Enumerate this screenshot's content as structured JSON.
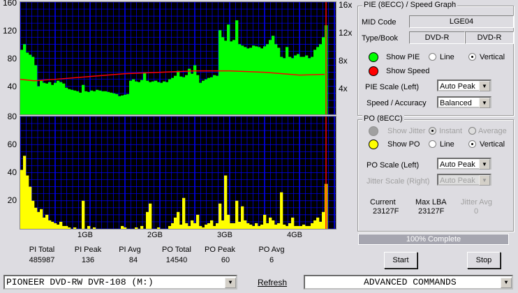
{
  "chart_data": [
    {
      "type": "bar",
      "title": "PI (8ECC)",
      "ylabel": "PIE",
      "ylim": [
        0,
        160
      ],
      "yticks": [
        40,
        80,
        120,
        160
      ],
      "xlim_gb": [
        0,
        4.5
      ],
      "x_step_gb": 0.04,
      "xticks": [
        "1GB",
        "2GB",
        "3GB",
        "4GB"
      ],
      "values": [
        92,
        100,
        88,
        85,
        82,
        70,
        40,
        48,
        45,
        44,
        46,
        42,
        45,
        48,
        46,
        44,
        38,
        36,
        35,
        34,
        33,
        31,
        42,
        33,
        32,
        34,
        33,
        35,
        34,
        33,
        33,
        32,
        31,
        30,
        29,
        26,
        27,
        28,
        29,
        48,
        50,
        47,
        46,
        49,
        60,
        48,
        46,
        47,
        48,
        46,
        45,
        47,
        46,
        50,
        52,
        55,
        62,
        54,
        53,
        56,
        65,
        58,
        70,
        56,
        45,
        48,
        50,
        52,
        53,
        56,
        55,
        120,
        110,
        105,
        128,
        104,
        106,
        134,
        100,
        98,
        96,
        94,
        95,
        98,
        97,
        96,
        94,
        97,
        100,
        106,
        112,
        100,
        95,
        82,
        80,
        96,
        82,
        80,
        84,
        86,
        82,
        82,
        84,
        80,
        82,
        92,
        96,
        100,
        110,
        127
      ],
      "speed": {
        "name": "Speed",
        "y2ticks": [
          "4x",
          "8x",
          "12x",
          "16x"
        ],
        "y2lim": [
          0,
          16
        ],
        "x": [
          0,
          0.2,
          0.5,
          1.0,
          1.5,
          2.0,
          2.5,
          3.0,
          3.5,
          4.0,
          4.36
        ],
        "y": [
          5,
          4.8,
          5,
          5.4,
          5.8,
          6.0,
          6.2,
          6.2,
          6.0,
          5.6,
          5.7
        ]
      },
      "end_gb": 4.38
    },
    {
      "type": "bar",
      "title": "PO (8ECC)",
      "ylim": [
        0,
        80
      ],
      "yticks": [
        20,
        40,
        60,
        80
      ],
      "x_step_gb": 0.04,
      "values": [
        42,
        52,
        38,
        30,
        20,
        15,
        12,
        14,
        8,
        10,
        6,
        5,
        4,
        3,
        5,
        2,
        2,
        1,
        0,
        1,
        0,
        0,
        20,
        0,
        2,
        0,
        1,
        0,
        0,
        0,
        0,
        0,
        0,
        0,
        0,
        0,
        2,
        1,
        0,
        0,
        0,
        1,
        0,
        2,
        0,
        12,
        18,
        0,
        0,
        1,
        0,
        0,
        0,
        2,
        4,
        8,
        12,
        3,
        22,
        4,
        2,
        6,
        4,
        10,
        2,
        1,
        3,
        4,
        6,
        2,
        4,
        18,
        6,
        38,
        10,
        4,
        4,
        20,
        5,
        16,
        6,
        4,
        3,
        2,
        4,
        2,
        3,
        10,
        4,
        8,
        6,
        3,
        4,
        26,
        3,
        2,
        4,
        8,
        2,
        2,
        2,
        3,
        2,
        2,
        4,
        6,
        8,
        5,
        12,
        32
      ]
    }
  ],
  "colors": {
    "pi": "#00ff00",
    "po": "#ffff00",
    "speed": "#ff0000",
    "grid": "#0000ff"
  },
  "stats": [
    {
      "label": "PI Total",
      "value": "485987"
    },
    {
      "label": "PI Peak",
      "value": "136"
    },
    {
      "label": "PI Avg",
      "value": "84"
    },
    {
      "label": "PO Total",
      "value": "14540"
    },
    {
      "label": "PO Peak",
      "value": "60"
    },
    {
      "label": "PO Avg",
      "value": "6"
    }
  ],
  "pie": {
    "title": "PIE (8ECC) / Speed Graph",
    "mid_label": "MID Code",
    "mid": "LGE04",
    "type_label": "Type/Book",
    "type": "DVD-R",
    "book": "DVD-R",
    "show_pie": "Show PIE",
    "line": "Line",
    "vertical": "Vertical",
    "show_speed": "Show Speed",
    "scale_label": "PIE Scale (Left)",
    "scale": "Auto Peak",
    "speed_label": "Speed / Accuracy",
    "speed": "Balanced"
  },
  "po": {
    "title": "PO (8ECC)",
    "show_jitter": "Show Jitter",
    "instant": "Instant",
    "average": "Average",
    "show_po": "Show PO",
    "line": "Line",
    "vertical": "Vertical",
    "scale_label": "PO Scale (Left)",
    "scale": "Auto Peak",
    "jitter_label": "Jitter Scale (Right)",
    "jitter_scale": "Auto Peak",
    "current_label": "Current",
    "current": "23127F",
    "maxlba_label": "Max LBA",
    "maxlba": "23127F",
    "jitter_avg_label": "Jitter Avg",
    "jitter_avg": "0"
  },
  "progress": {
    "text": "100% Complete",
    "percent": 100
  },
  "buttons": {
    "start": "Start",
    "stop": "Stop",
    "refresh": "Refresh"
  },
  "drive": "PIONEER DVD-RW  DVR-108  (M:)",
  "advanced": "ADVANCED COMMANDS"
}
